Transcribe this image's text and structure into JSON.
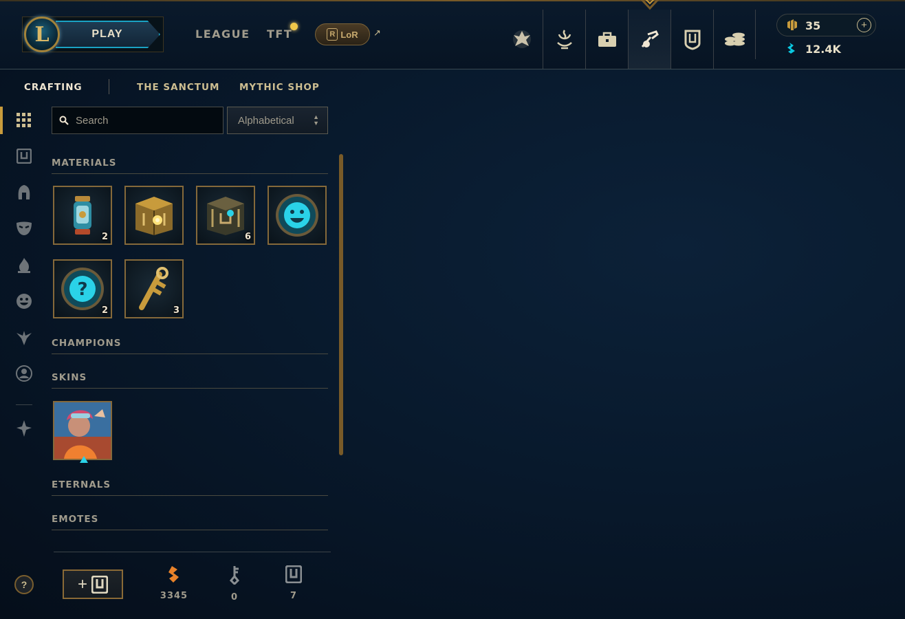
{
  "header": {
    "logo_letter": "L",
    "play_label": "PLAY",
    "nav": [
      {
        "label": "LEAGUE"
      },
      {
        "label": "TFT"
      }
    ],
    "lor_label": "LoR",
    "lor_badge": "R",
    "external_arrow": "↗",
    "icon_tabs": [
      {
        "icon": "home-icon"
      },
      {
        "icon": "profile-icon"
      },
      {
        "icon": "collection-icon"
      },
      {
        "icon": "loot-icon",
        "active": true
      },
      {
        "icon": "hextech-chest-icon"
      },
      {
        "icon": "store-icon"
      }
    ],
    "currency": {
      "rp": "35",
      "be": "12.4K",
      "add": "+"
    }
  },
  "subtabs": [
    {
      "label": "CRAFTING",
      "active": true
    },
    {
      "label": "THE SANCTUM"
    },
    {
      "label": "MYTHIC SHOP"
    }
  ],
  "filters": {
    "search_placeholder": "Search",
    "sort_value": "Alphabetical"
  },
  "sections": {
    "materials": "MATERIALS",
    "champions": "CHAMPIONS",
    "skins": "SKINS",
    "eternals": "ETERNALS",
    "emotes": "EMOTES"
  },
  "materials": [
    {
      "icon": "capsule-icon",
      "count": "2"
    },
    {
      "icon": "masterwork-chest-icon",
      "count": ""
    },
    {
      "icon": "hextech-chest-icon",
      "count": "6"
    },
    {
      "icon": "emote-orb-icon",
      "count": ""
    },
    {
      "icon": "mystery-orb-icon",
      "count": "2"
    },
    {
      "icon": "key-fragment-icon",
      "count": "3"
    }
  ],
  "skins": [
    {
      "icon": "skin-portrait-icon"
    }
  ],
  "footer": {
    "help": "?",
    "add_chest_plus": "+",
    "stats": [
      {
        "icon": "orange-essence-icon",
        "value": "3345"
      },
      {
        "icon": "key-icon",
        "value": "0"
      },
      {
        "icon": "chest-icon",
        "value": "7"
      }
    ]
  },
  "colors": {
    "gold": "#c89b3c",
    "accent_blue": "#0ac8b9",
    "text": "#a09b8c",
    "active_text": "#f0e6d2"
  }
}
